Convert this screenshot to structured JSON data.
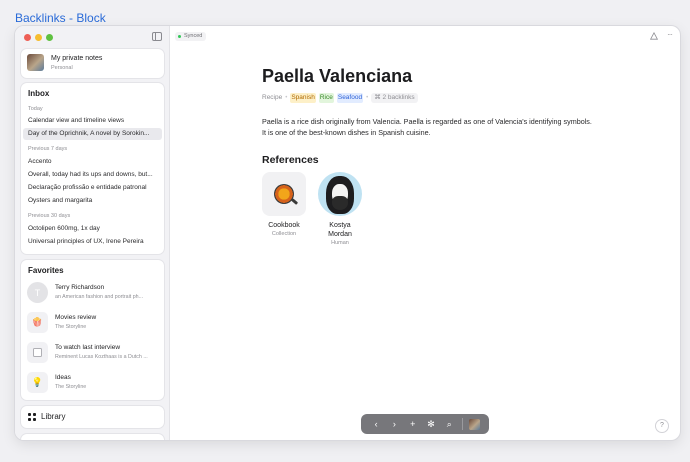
{
  "page": {
    "title": "Backlinks - Block"
  },
  "account": {
    "name": "My private notes",
    "subtitle": "Personal"
  },
  "inbox": {
    "title": "Inbox",
    "groups": [
      {
        "label": "Today",
        "items": [
          "Calendar view and timeline views",
          "Day of the Oprichnik, A novel by Sorokin..."
        ]
      },
      {
        "label": "Previous 7 days",
        "items": [
          "Accento",
          "Overall, today had its ups and downs, but...",
          "Declaração profissão e entidade patronal",
          "Oysters and margarita"
        ]
      },
      {
        "label": "Previous 30 days",
        "items": [
          "Octolipen 600mg, 1x day",
          "Universal principles of UX, Irene Pereira"
        ]
      }
    ]
  },
  "favorites": {
    "title": "Favorites",
    "items": [
      {
        "icon": "person-avatar-icon",
        "glyph": "T",
        "title": "Terry Richardson",
        "subtitle": "an American fashion and portrait ph..."
      },
      {
        "icon": "popcorn-icon",
        "glyph": "🍿",
        "title": "Movies review",
        "subtitle": "The Storyline"
      },
      {
        "icon": "checkbox-icon",
        "glyph": "",
        "title": "To watch last interview",
        "subtitle": "Reminent Lucas Kozthaas is a Dutch ..."
      },
      {
        "icon": "lightbulb-icon",
        "glyph": "💡",
        "title": "Ideas",
        "subtitle": "The Storyline"
      }
    ]
  },
  "library": {
    "label": "Library"
  },
  "status": {
    "synced": "Synced"
  },
  "document": {
    "title": "Paella Valenciana",
    "type": "Recipe",
    "tags": [
      {
        "label": "Spanish",
        "color": "#b06a00"
      },
      {
        "label": "Rice",
        "color": "#3a8a2a"
      },
      {
        "label": "Seafood",
        "color": "#2e62d8"
      }
    ],
    "backlinks": "2 backlinks",
    "body": "Paella is a rice dish originally from Valencia. Paella is regarded as one of Valencia's identifying symbols. It is one of the best-known dishes in Spanish cuisine.",
    "references_title": "References",
    "references": [
      {
        "name": "Cookbook",
        "type": "Collection",
        "icon": "paella-pan-icon"
      },
      {
        "name": "Kostya Mordan",
        "type": "Human",
        "icon": "portrait-avatar"
      }
    ]
  },
  "toolbar": {
    "back": "‹",
    "forward": "›",
    "add": "+",
    "graph": "✻",
    "search": "⌕"
  },
  "help": {
    "label": "?"
  }
}
